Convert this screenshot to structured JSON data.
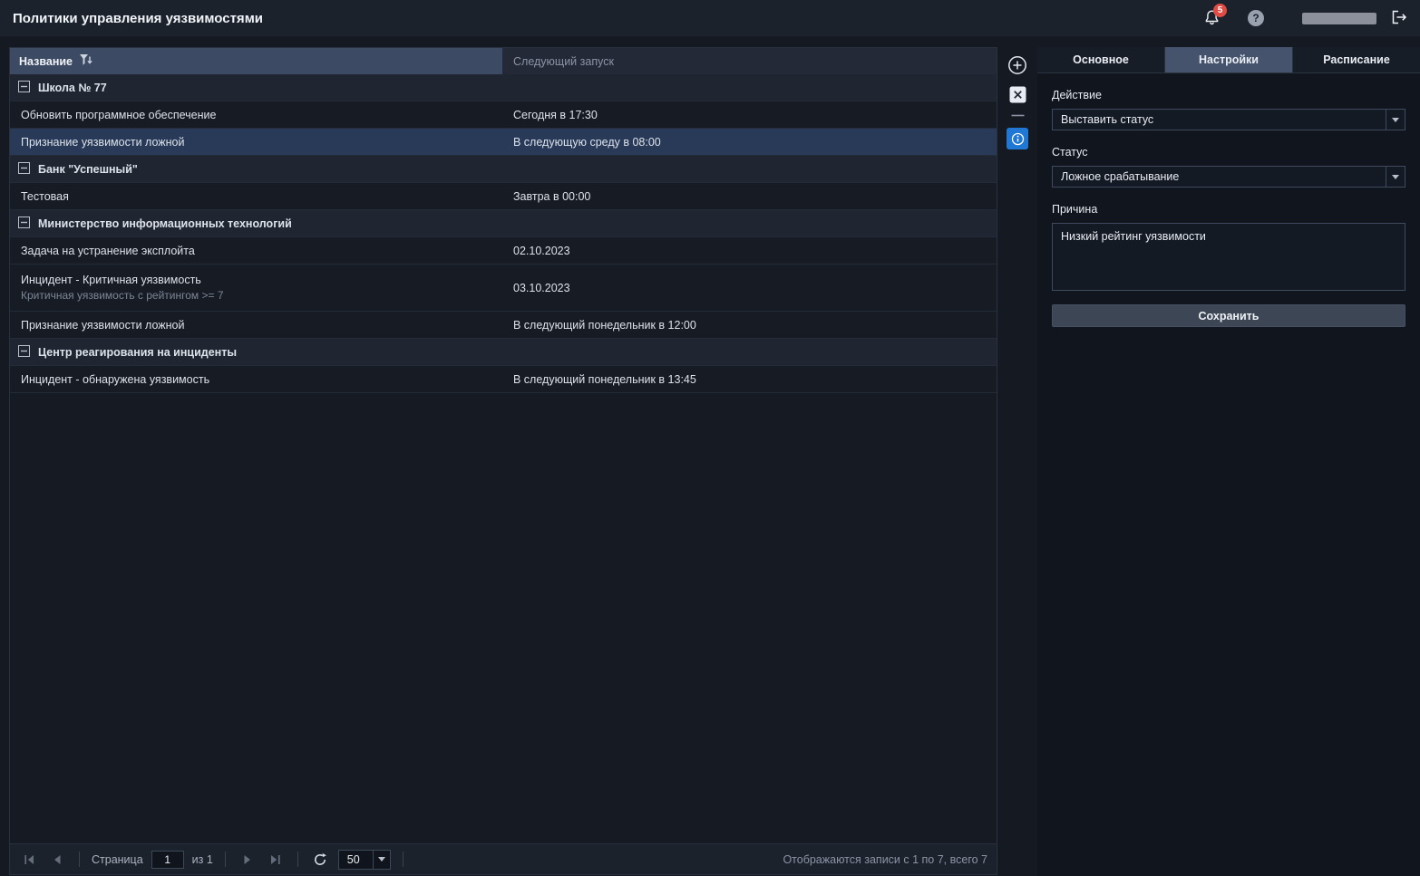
{
  "header": {
    "title": "Политики управления уязвимостями",
    "notification_badge": "5",
    "help_symbol": "?"
  },
  "colors": {
    "accent_blue": "#2178d4",
    "badge_red": "#e14b44",
    "selected_row": "#283a58",
    "sorted_column_header": "#3c4a63"
  },
  "grid": {
    "columns": {
      "name": "Название",
      "next_run": "Следующий запуск"
    },
    "rows": [
      {
        "type": "group",
        "name": "Школа № 77"
      },
      {
        "type": "row",
        "name": "Обновить программное обеспечение",
        "next": "Сегодня в 17:30"
      },
      {
        "type": "row",
        "name": "Признание уязвимости ложной",
        "next": "В следующую среду в 08:00",
        "selected": true
      },
      {
        "type": "group",
        "name": "Банк \"Успешный\""
      },
      {
        "type": "row",
        "name": "Тестовая",
        "next": "Завтра в 00:00"
      },
      {
        "type": "group",
        "name": "Министерство информационных технологий"
      },
      {
        "type": "row",
        "name": "Задача на устранение эксплойта",
        "next": "02.10.2023"
      },
      {
        "type": "row",
        "name": "Инцидент - Критичная уязвимость",
        "subtitle": "Критичная уязвимость с рейтингом >= 7",
        "next": "03.10.2023"
      },
      {
        "type": "row",
        "name": "Признание уязвимости ложной",
        "next": "В следующий понедельник в 12:00"
      },
      {
        "type": "group",
        "name": "Центр реагирования на инциденты"
      },
      {
        "type": "row",
        "name": "Инцидент - обнаружена уязвимость",
        "next": "В следующий понедельник в 13:45"
      }
    ],
    "pagination": {
      "page_label": "Страница",
      "page_value": "1",
      "of_label": "из 1",
      "page_size": "50",
      "summary": "Отображаются записи с 1 по 7, всего 7"
    }
  },
  "detail": {
    "tabs": [
      {
        "label": "Основное"
      },
      {
        "label": "Настройки",
        "active": true
      },
      {
        "label": "Расписание"
      }
    ],
    "action": {
      "label": "Действие",
      "value": "Выставить статус"
    },
    "status": {
      "label": "Статус",
      "value": "Ложное срабатывание"
    },
    "reason": {
      "label": "Причина",
      "value": "Низкий рейтинг уязвимости"
    },
    "save_label": "Сохранить"
  }
}
